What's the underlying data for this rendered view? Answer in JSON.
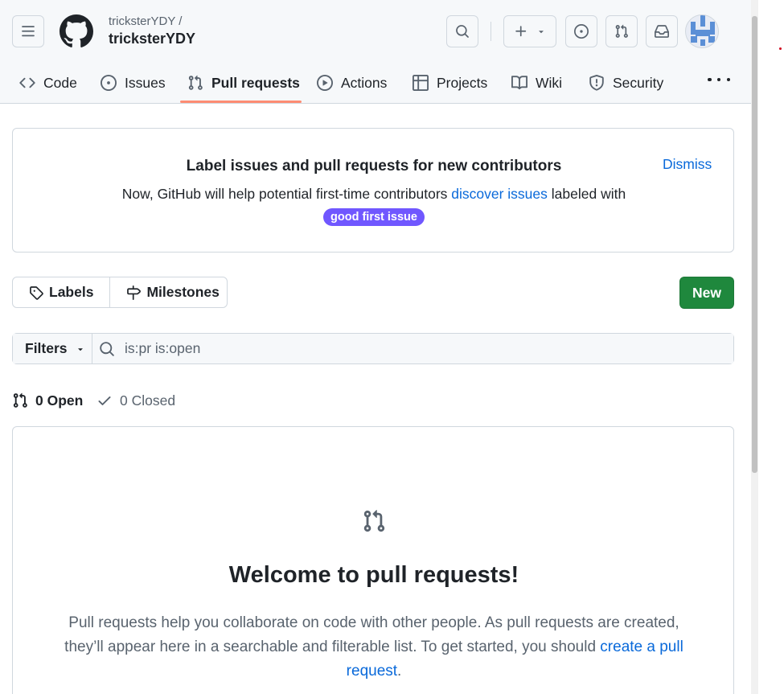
{
  "header": {
    "owner": "tricksterYDY /",
    "repo": "tricksterYDY"
  },
  "tabs": [
    {
      "label": "Code",
      "icon": "code-icon"
    },
    {
      "label": "Issues",
      "icon": "issue-opened-icon"
    },
    {
      "label": "Pull requests",
      "icon": "git-pull-request-icon",
      "active": true
    },
    {
      "label": "Actions",
      "icon": "play-icon"
    },
    {
      "label": "Projects",
      "icon": "table-icon"
    },
    {
      "label": "Wiki",
      "icon": "book-icon"
    },
    {
      "label": "Security",
      "icon": "shield-icon"
    }
  ],
  "banner": {
    "title": "Label issues and pull requests for new contributors",
    "text_before": "Now, GitHub will help potential first-time contributors ",
    "link": "discover issues",
    "text_after": " labeled with ",
    "label": "good first issue",
    "dismiss": "Dismiss"
  },
  "toolbar": {
    "labels": "Labels",
    "milestones": "Milestones",
    "new": "New"
  },
  "filter": {
    "button": "Filters",
    "query": "is:pr is:open"
  },
  "state": {
    "open": "0 Open",
    "closed": "0 Closed"
  },
  "blankslate": {
    "title": "Welcome to pull requests!",
    "text": "Pull requests help you collaborate on code with other people. As pull requests are created, they’ll appear here in a searchable and filterable list. To get started, you should ",
    "link": "create a pull request",
    "text_end": "."
  },
  "colors": {
    "accent": "#0969da",
    "primary_button": "#1f883d",
    "active_tab_underline": "#fd8c73",
    "good_first_issue": "#7057ff"
  }
}
